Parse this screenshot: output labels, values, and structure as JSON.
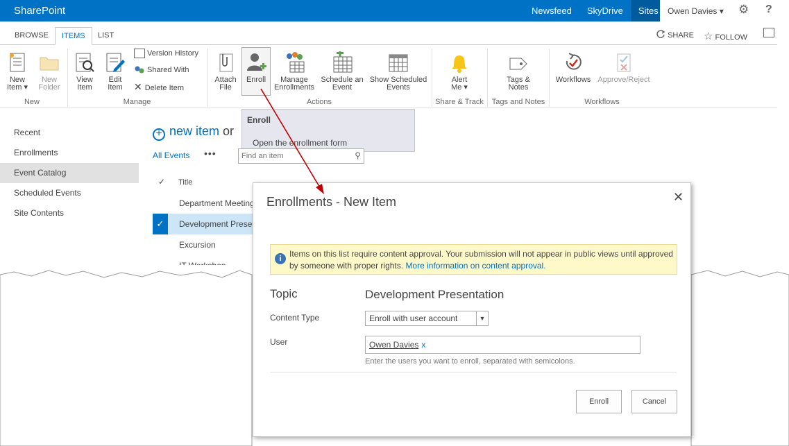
{
  "suitebar": {
    "brand": "SharePoint",
    "links": [
      "Newsfeed",
      "SkyDrive",
      "Sites"
    ],
    "active_link": "Sites",
    "user": "Owen Davies",
    "user_caret": "▾",
    "gear": "⚙",
    "help": "?"
  },
  "tabs": {
    "browse": "BROWSE",
    "items": "ITEMS",
    "list": "LIST",
    "share": "SHARE",
    "follow": "FOLLOW"
  },
  "ribbon": {
    "new_item": "New",
    "new_item2": "Item ▾",
    "new_folder": "New",
    "new_folder2": "Folder",
    "view_item": "View",
    "view_item2": "Item",
    "edit_item": "Edit",
    "edit_item2": "Item",
    "version_history": "Version History",
    "shared_with": "Shared With",
    "delete_item": "Delete Item",
    "attach_file": "Attach",
    "attach_file2": "File",
    "enroll": "Enroll",
    "manage_enrollments": "Manage",
    "manage_enrollments2": "Enrollments",
    "schedule_event": "Schedule an",
    "schedule_event2": "Event",
    "show_scheduled": "Show Scheduled",
    "show_scheduled2": "Events",
    "alert_me": "Alert",
    "alert_me2": "Me ▾",
    "tags_notes": "Tags &",
    "tags_notes2": "Notes",
    "workflows": "Workflows",
    "approve_reject": "Approve/Reject",
    "groups": [
      "New",
      "Manage",
      "Actions",
      "Share & Track",
      "Tags and Notes",
      "Workflows"
    ]
  },
  "tooltip": {
    "title": "Enroll",
    "description": "Open the enrollment form"
  },
  "leftnav": [
    "Recent",
    "Enrollments",
    "Event Catalog",
    "Scheduled Events",
    "Site Contents"
  ],
  "list": {
    "new_item": "new item",
    "or": "or",
    "view": "All Events",
    "more": "•••",
    "search_placeholder": "Find an item",
    "col_title": "Title",
    "check": "✓",
    "rows": [
      "Department Meeting",
      "Development Presentation",
      "Excursion",
      "IT Workshop"
    ]
  },
  "dialog": {
    "title": "Enrollments - New Item",
    "close": "✕",
    "notice_text": "Items on this list require content approval. Your submission will not appear in public views until approved by someone with proper rights.",
    "notice_link": "More information on content approval.",
    "topic_label": "Topic",
    "topic_value": "Development Presentation",
    "content_type_label": "Content Type",
    "content_type_value": "Enroll with user account",
    "user_label": "User",
    "user_value": "Owen Davies",
    "user_remove": "x",
    "user_hint": "Enter the users you want to enroll, separated with semicolons.",
    "enroll_button": "Enroll",
    "cancel_button": "Cancel"
  }
}
